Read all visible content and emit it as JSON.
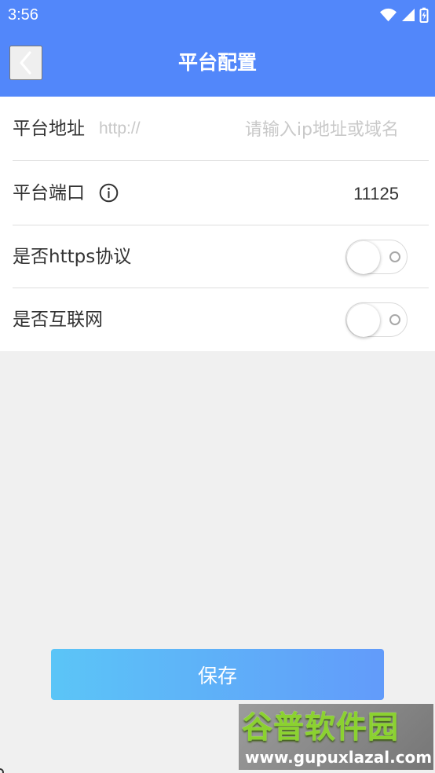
{
  "status_bar": {
    "time": "3:56",
    "icons": [
      "wifi-icon",
      "cellular-icon",
      "battery-charging-icon"
    ]
  },
  "header": {
    "title": "平台配置",
    "back_icon": "chevron-left-icon"
  },
  "settings": {
    "address": {
      "label": "平台地址",
      "prefix": "http://",
      "value": "",
      "placeholder": "请输入ip地址或域名"
    },
    "port": {
      "label": "平台端口",
      "value": "11125",
      "info_icon": "info-icon"
    },
    "https": {
      "label": "是否https协议",
      "enabled": false
    },
    "internet": {
      "label": "是否互联网",
      "enabled": false
    }
  },
  "actions": {
    "save_label": "保存"
  },
  "watermark": {
    "title": "谷普软件园",
    "url": "www.gupuxlazal.com"
  },
  "colors": {
    "header": "#5287fa",
    "background": "#f0f0f0",
    "surface": "#ffffff",
    "divider": "#dedede",
    "text": "#333333",
    "placeholder": "#c9c9c9",
    "button_start": "#5bc5f7",
    "button_end": "#629bfa",
    "watermark_green": "#8bd22f"
  }
}
